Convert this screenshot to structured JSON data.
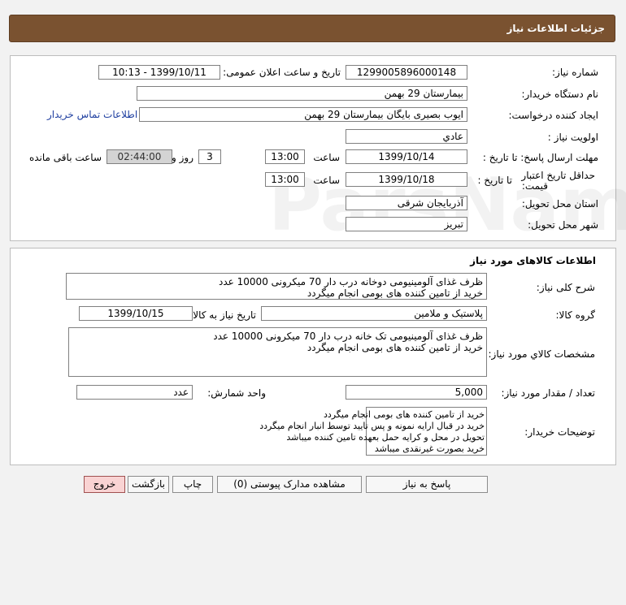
{
  "header": {
    "title": "جزئیات اطلاعات نیاز"
  },
  "request": {
    "need_number_label": "شماره نیاز:",
    "need_number": "1299005896000148",
    "announce_label": "تاریخ و ساعت اعلان عمومی:",
    "announce_value": "1399/10/11 - 10:13",
    "buyer_label": "نام دستگاه خریدار:",
    "buyer_value": "بیمارستان 29 بهمن",
    "creator_label": "ایجاد کننده درخواست:",
    "creator_value": "ایوب بصیری  بایگان بیمارستان 29 بهمن",
    "contact_link": "اطلاعات تماس خریدار",
    "priority_label": "اولویت نیاز :",
    "priority_value": "عادي",
    "send_deadline_label": "مهلت ارسال پاسخ:  تا تاریخ :",
    "send_date": "1399/10/14",
    "time_label": "ساعت",
    "send_time": "13:00",
    "days_value": "3",
    "days_label": "روز و",
    "remaining_time": "02:44:00",
    "remaining_label": "ساعت باقی مانده",
    "validity_label_line1": "حداقل تاریخ اعتبار",
    "validity_label_line2": "قیمت:",
    "validity_to_label": "تا تاریخ :",
    "validity_date": "1399/10/18",
    "validity_time": "13:00",
    "province_label": "استان محل تحویل:",
    "province_value": "آذربایجان شرقی",
    "city_label": "شهر محل تحویل:",
    "city_value": "تبریز"
  },
  "goods": {
    "section_title": "اطلاعات کالاهای مورد نیاز",
    "summary_label": "شرح کلی نیاز:",
    "summary_lines": [
      "ظرف غذای آلومینیومی دوخانه درب دار 70 میکرونی 10000 عدد",
      "خرید از تامین کننده های بومی انجام میگردد"
    ],
    "group_label": "گروه کالا:",
    "group_value": "پلاستیک و ملامین",
    "need_date_label": "تاریخ نیاز به کالا:",
    "need_date_value": "1399/10/15",
    "spec_label": "مشخصات کالاي مورد نياز:",
    "spec_lines": [
      "ظرف غذای آلومینیومی تک خانه درب دار 70 میکرونی 10000 عدد",
      "خرید از تامین کننده های بومی انجام میگردد"
    ],
    "qty_label": "تعداد / مقدار مورد نیاز:",
    "qty_value": "5,000",
    "unit_label": "واحد شمارش:",
    "unit_value": "عدد",
    "buyer_notes_label": "توضیحات خریدار:",
    "buyer_notes_lines": [
      "خرید از تامین کننده های بومی انجام میگردد",
      "خرید در قبال ارایه نمونه و پس تایید توسط انبار انجام میگردد",
      "تحویل در محل و کرایه حمل بعهده تامین کننده میباشد",
      "خرید بصورت غیرنقدی میباشد"
    ]
  },
  "buttons": {
    "reply": "پاسخ به نیاز",
    "attachments": "مشاهده مدارک پیوستی (0)",
    "print": "چاپ",
    "back": "بازگشت",
    "exit": "خروج"
  },
  "colors": {
    "title_bar": "#7a5230",
    "exit_button": "#f9d3d3",
    "link": "#1f3fa0"
  }
}
